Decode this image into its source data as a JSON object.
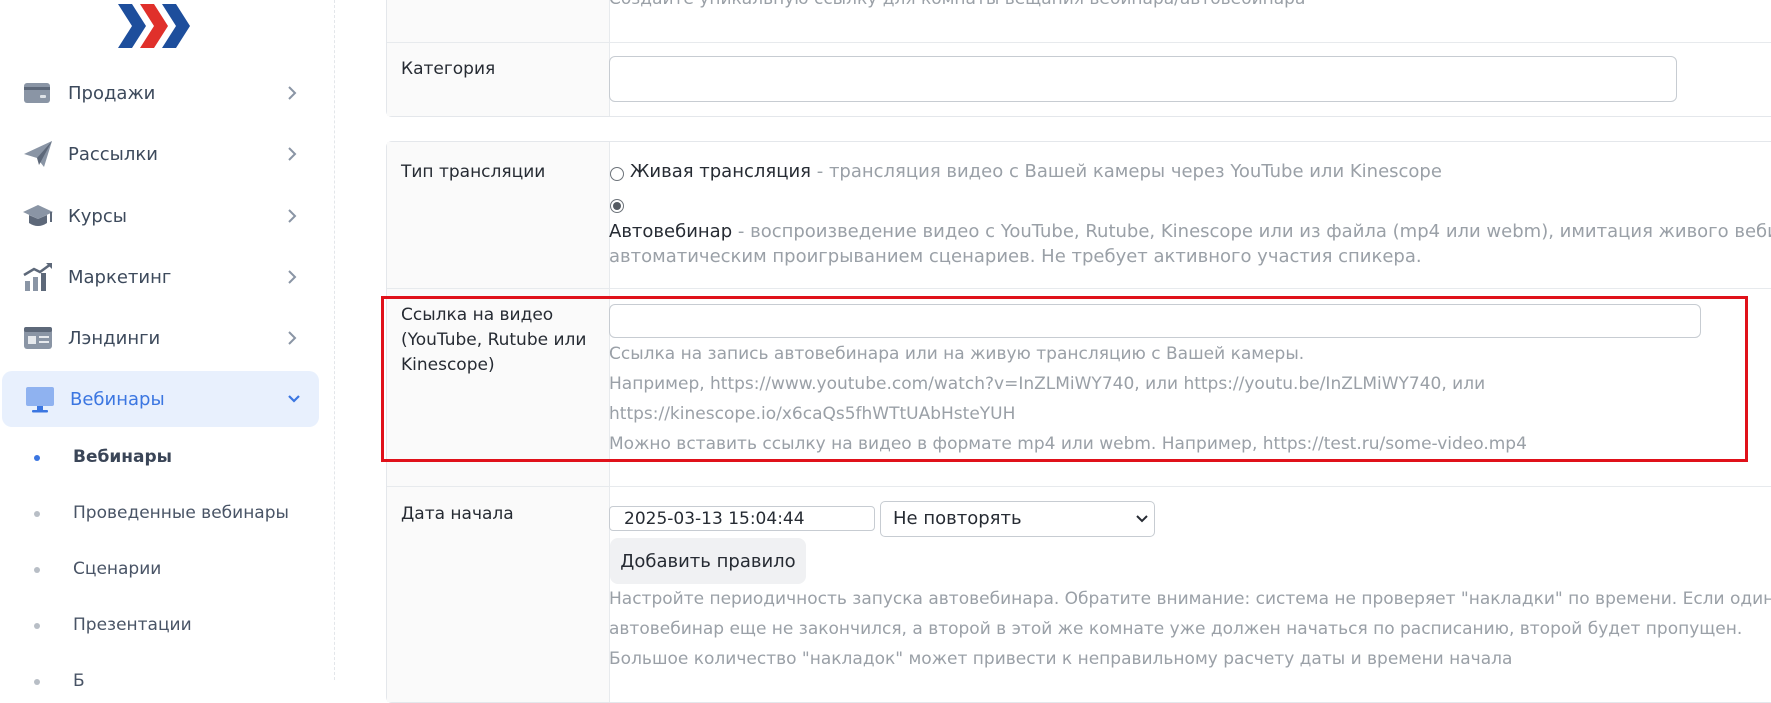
{
  "colors": {
    "accent": "#3b76e1",
    "highlight": "#e0111a",
    "logo_red": "#e0302b",
    "logo_blue": "#1d4e9c"
  },
  "sidebar": {
    "logo_icon": "brand-chevrons-logo",
    "items": [
      {
        "label": "Продажи",
        "icon": "wallet-icon"
      },
      {
        "label": "Рассылки",
        "icon": "paper-plane-icon"
      },
      {
        "label": "Курсы",
        "icon": "graduation-cap-icon"
      },
      {
        "label": "Маркетинг",
        "icon": "growth-chart-icon"
      },
      {
        "label": "Лэндинги",
        "icon": "landing-card-icon"
      },
      {
        "label": "Вебинары",
        "icon": "monitor-icon",
        "expanded": true
      }
    ],
    "sub_items": [
      {
        "label": "Вебинары",
        "active": true
      },
      {
        "label": "Проведенные вебинары"
      },
      {
        "label": "Сценарии"
      },
      {
        "label": "Презентации"
      },
      {
        "label": "Б"
      }
    ]
  },
  "form": {
    "top_hint": "Создайте уникальную ссылку для комнаты вещания вебинара/автовебинара",
    "category": {
      "label": "Категория",
      "value": ""
    },
    "broadcast_type": {
      "label": "Тип трансляции",
      "options": [
        {
          "title": "Живая трансляция",
          "desc": " - трансляция видео с Вашей камеры через YouTube или Kinescope",
          "checked": false
        },
        {
          "title": "Автовебинар",
          "desc_line1": " - воспроизведение видео с YouTube, Rutube, Kinescope или из файла (mp4 или webm), имитация живого вебинара с",
          "desc_line2": "автоматическим проигрыванием сценариев. Не требует активного участия спикера.",
          "checked": true
        }
      ]
    },
    "video_link": {
      "label_line1": "Ссылка на видео",
      "label_line2": "(YouTube, Rutube или",
      "label_line3": "Kinescope)",
      "value": "",
      "hint_line1": "Ссылка на запись автовебинара или на живую трансляцию с Вашей камеры.",
      "hint_line2": "Например, https://www.youtube.com/watch?v=InZLMiWY740, или https://youtu.be/InZLMiWY740, или",
      "hint_line3": "https://kinescope.io/x6caQs5fhWTtUAbHsteYUH",
      "hint_line4": "Можно вставить ссылку на видео в формате mp4 или webm. Например, https://test.ru/some-video.mp4"
    },
    "start_date": {
      "label": "Дата начала",
      "value": "2025-03-13 15:04:44",
      "repeat_selected": "Не повторять",
      "add_rule_label": "Добавить правило",
      "hint_line1": "Настройте периодичность запуска автовебинара. Обратите внимание: система не проверяет \"накладки\" по времени. Если один",
      "hint_line2": "автовебинар еще не закончился, а второй в этой же комнате уже должен начаться по расписанию, второй будет пропущен.",
      "hint_line3": "Большое количество \"накладок\" может привести к неправильному расчету даты и времени начала"
    }
  }
}
